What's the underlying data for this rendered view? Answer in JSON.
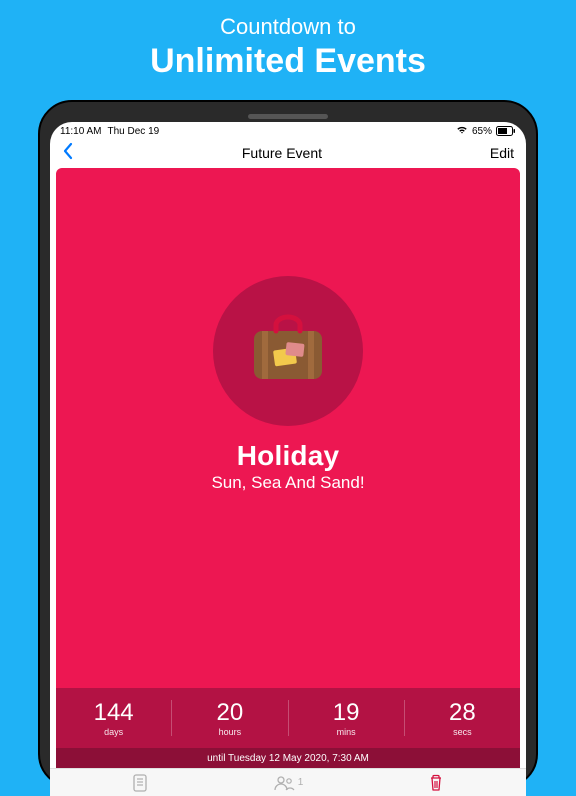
{
  "promo": {
    "line1": "Countdown to",
    "line2": "Unlimited Events"
  },
  "status": {
    "time": "11:10 AM",
    "date": "Thu Dec 19",
    "signal": "●●●●",
    "wifi": "▲",
    "battery_pct": "65%"
  },
  "nav": {
    "title": "Future Event",
    "edit": "Edit"
  },
  "event": {
    "title": "Holiday",
    "subtitle": "Sun, Sea And Sand!",
    "icon": "suitcase-icon",
    "countdown": [
      {
        "value": "144",
        "label": "days"
      },
      {
        "value": "20",
        "label": "hours"
      },
      {
        "value": "19",
        "label": "mins"
      },
      {
        "value": "28",
        "label": "secs"
      }
    ],
    "until": "until Tuesday 12 May 2020, 7:30 AM"
  },
  "tabs": {
    "people_count": "1"
  },
  "colors": {
    "accent": "#1fb2f6",
    "card": "#ed1752",
    "card_dark": "#b31244",
    "card_darker": "#8c0f37"
  }
}
